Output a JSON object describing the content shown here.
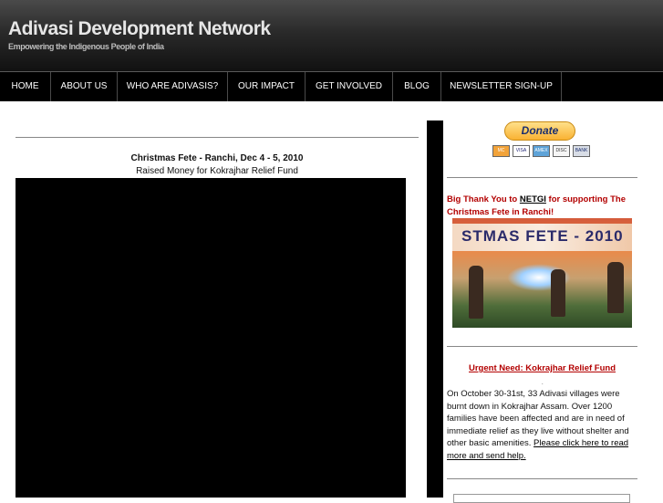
{
  "header": {
    "title": "Adivasi Development Network",
    "tagline": "Empowering the Indigenous People of India"
  },
  "nav": {
    "items": [
      {
        "label": "HOME"
      },
      {
        "label": "ABOUT US"
      },
      {
        "label": "WHO ARE ADIVASIS?"
      },
      {
        "label": "OUR IMPACT"
      },
      {
        "label": "GET INVOLVED"
      },
      {
        "label": "BLOG"
      },
      {
        "label": "NEWSLETTER SIGN-UP"
      }
    ]
  },
  "main": {
    "post_title": "Christmas Fete - Ranchi, Dec 4 - 5, 2010",
    "post_subtitle": "Raised Money for Kokrajhar Relief Fund"
  },
  "sidebar": {
    "donate_label": "Donate",
    "cards": [
      {
        "name": "mastercard-icon",
        "label": "MC"
      },
      {
        "name": "visa-icon",
        "label": "VISA"
      },
      {
        "name": "amex-icon",
        "label": "AMEX"
      },
      {
        "name": "discover-icon",
        "label": "DISC"
      },
      {
        "name": "bank-icon",
        "label": "BANK"
      }
    ],
    "thanks_prefix": "Big Thank You to ",
    "thanks_link": "NETGI",
    "thanks_suffix": " for supporting The Christmas Fete in Ranchi!",
    "photo_banner": "STMAS FETE - 2010",
    "urgent_title": "Urgent Need: Kokrajhar Relief Fund",
    "body": "On October 30-31st, 33 Adivasi villages were burnt down in Kokrajhar Assam. Over 1200 families have been affected and are in need of immediate relief as they live without shelter and other basic amenities. ",
    "body_link": "Please click here to read more and send help."
  },
  "colors": {
    "accent_red": "#b30000",
    "nav_bg": "#000000",
    "header_bg": "#2a2a2a"
  }
}
